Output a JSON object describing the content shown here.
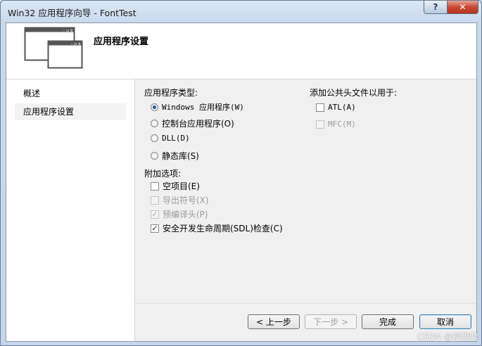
{
  "window": {
    "title": "Win32 应用程序向导 - FontTest",
    "help_glyph": "?",
    "close_glyph": "✕"
  },
  "header": {
    "title": "应用程序设置"
  },
  "nav": {
    "items": [
      {
        "label": "概述"
      },
      {
        "label": "应用程序设置"
      }
    ]
  },
  "app_type": {
    "label": "应用程序类型:",
    "options": [
      {
        "label": "Windows 应用程序(W)"
      },
      {
        "label": "控制台应用程序(O)"
      },
      {
        "label": "DLL(D)"
      },
      {
        "label": "静态库(S)"
      }
    ]
  },
  "extra_options": {
    "label": "附加选项:",
    "items": [
      {
        "label": "空项目(E)"
      },
      {
        "label": "导出符号(X)"
      },
      {
        "label": "预编译头(P)"
      },
      {
        "label": "安全开发生命周期(SDL)检查(C)"
      }
    ]
  },
  "common_headers": {
    "label": "添加公共头文件以用于:",
    "items": [
      {
        "label": "ATL(A)"
      },
      {
        "label": "MFC(M)"
      }
    ]
  },
  "buttons": {
    "prev": "< 上一步",
    "next": "下一步 >",
    "finish": "完成",
    "cancel": "取消"
  },
  "watermark": "CSDN @柳鲲鹏"
}
